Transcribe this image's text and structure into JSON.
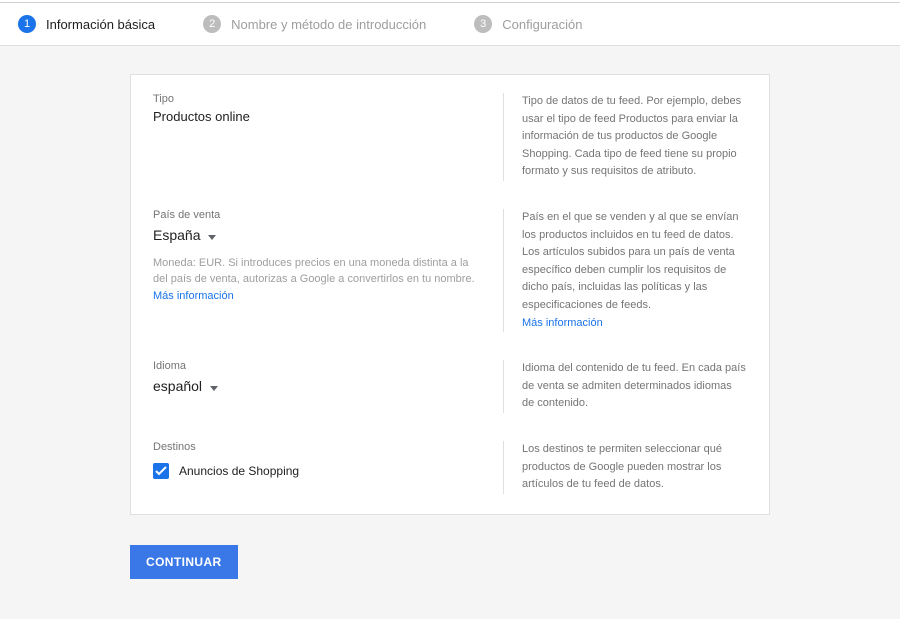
{
  "stepper": {
    "steps": [
      {
        "num": "1",
        "label": "Información básica"
      },
      {
        "num": "2",
        "label": "Nombre y método de introducción"
      },
      {
        "num": "3",
        "label": "Configuración"
      }
    ]
  },
  "form": {
    "type": {
      "label": "Tipo",
      "value": "Productos online",
      "help": "Tipo de datos de tu feed. Por ejemplo, debes usar el tipo de feed Productos para enviar la información de tus productos de Google Shopping. Cada tipo de feed tiene su propio formato y sus requisitos de atributo."
    },
    "country": {
      "label": "País de venta",
      "value": "España",
      "hint": "Moneda: EUR. Si introduces precios en una moneda distinta a la del país de venta, autorizas a Google a convertirlos en tu nombre. ",
      "hint_link": "Más información",
      "help": "País en el que se venden y al que se envían los productos incluidos en tu feed de datos. Los artículos subidos para un país de venta específico deben cumplir los requisitos de dicho país, incluidas las políticas y las especificaciones de feeds.",
      "help_link": "Más información"
    },
    "language": {
      "label": "Idioma",
      "value": "español",
      "help": "Idioma del contenido de tu feed. En cada país de venta se admiten determinados idiomas de contenido."
    },
    "destinations": {
      "label": "Destinos",
      "option": "Anuncios de Shopping",
      "help": "Los destinos te permiten seleccionar qué productos de Google pueden mostrar los artículos de tu feed de datos."
    }
  },
  "buttons": {
    "continue": "CONTINUAR"
  }
}
